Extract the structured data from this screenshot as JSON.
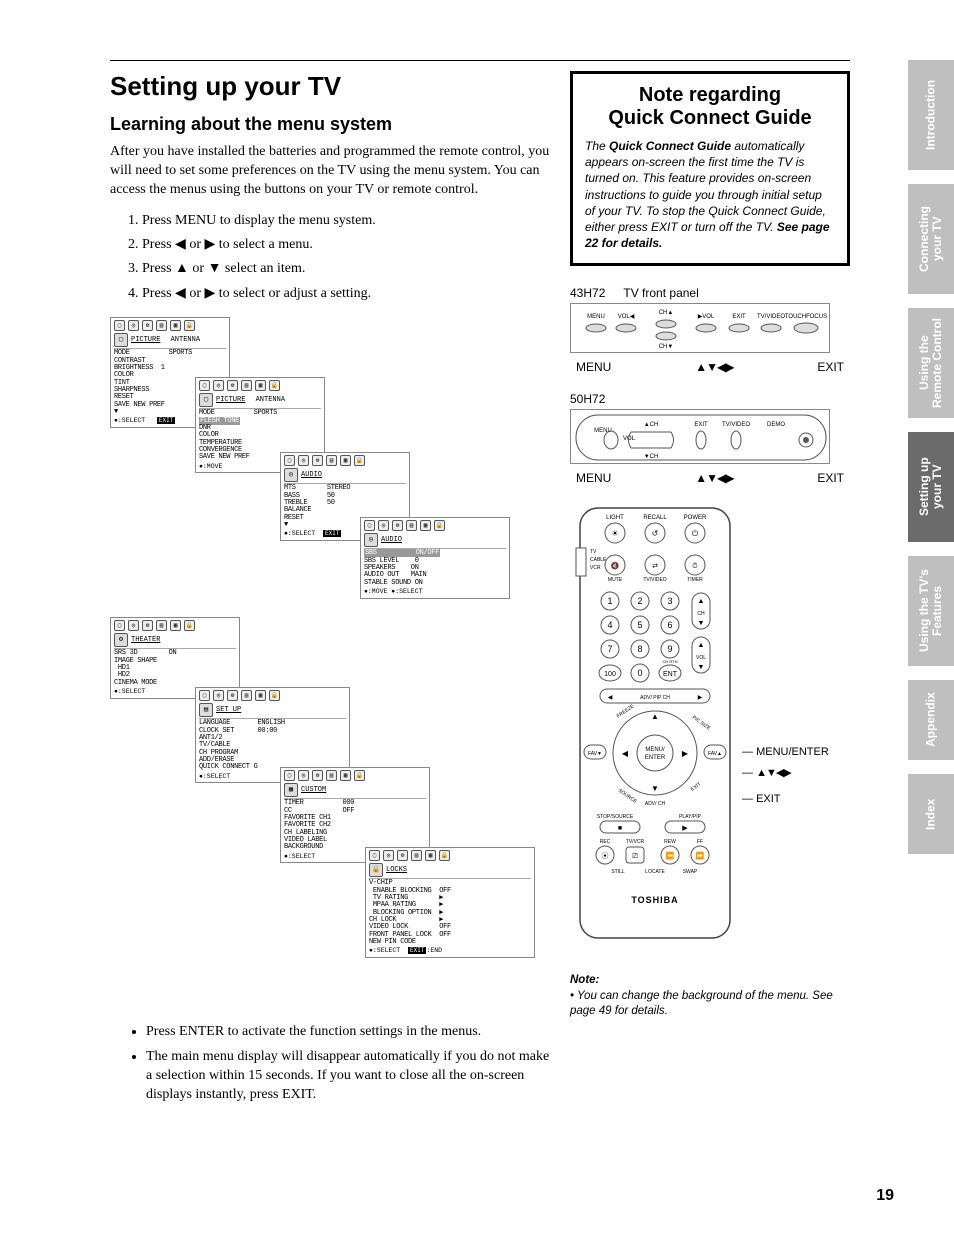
{
  "page_number": "19",
  "heading": "Setting up your TV",
  "subheading": "Learning about the menu system",
  "intro": "After you have installed the batteries and programmed the remote control, you will need to set some preferences on the TV using the menu system. You can access the menus using the buttons on your TV or remote control.",
  "steps": [
    "Press MENU to display the menu system.",
    "Press ◀ or ▶ to select a menu.",
    "Press ▲ or ▼ select an item.",
    "Press ◀ or ▶ to select or adjust a setting."
  ],
  "bullets": [
    "Press ENTER to activate the function settings in the menus.",
    "The main menu display will disappear automatically if you do not make a selection within 15 seconds. If you want to close all the on-screen displays instantly, press EXIT."
  ],
  "callout": {
    "title_line1": "Note regarding",
    "title_line2": "Quick Connect Guide",
    "body_lead": "The ",
    "body_bold1": "Quick Connect Guide",
    "body_mid": " automatically appears on-screen the first time the TV is turned on. This feature provides on-screen instructions to guide you through initial setup of your TV. To stop the Quick Connect Guide, either press EXIT or turn off the TV. ",
    "body_bold2": "See page 22 for details."
  },
  "panel1": {
    "model": "43H72",
    "label": "TV front panel",
    "buttons": [
      "MENU",
      "VOL◀",
      "CH▲",
      "▶VOL",
      "EXIT",
      "TV/VIDEO",
      "TOUCHFOCUS"
    ],
    "ch_down": "CH▼",
    "cap_left": "MENU",
    "cap_arrows": "▲▼◀▶",
    "cap_right": "EXIT"
  },
  "panel2": {
    "model": "50H72",
    "buttons_left": [
      "MENU",
      "VOL"
    ],
    "buttons_mid": [
      "CH",
      "CH"
    ],
    "buttons_right": [
      "EXIT",
      "TV/VIDEO",
      "DEMO"
    ],
    "cap_left": "MENU",
    "cap_arrows": "▲▼◀▶",
    "cap_right": "EXIT"
  },
  "remote": {
    "brand": "TOSHIBA",
    "top_row": [
      "LIGHT",
      "RECALL",
      "POWER"
    ],
    "side_switch": [
      "TV",
      "CABLE",
      "VCR"
    ],
    "row2": [
      "MUTE",
      "TV/VIDEO",
      "TIMER"
    ],
    "keypad": [
      [
        "1",
        "2",
        "3"
      ],
      [
        "4",
        "5",
        "6"
      ],
      [
        "7",
        "8",
        "9"
      ],
      [
        "100",
        "0",
        "ENT"
      ]
    ],
    "ch_label": "CH",
    "vol_label": "VOL",
    "chrtn": "CH RTN",
    "adv_pip": "ADV/\nPIP CH",
    "freeze": "FREEZE",
    "picsize": "PIC SIZE",
    "center": "MENU/\nENTER",
    "fav_l": "FAV▼",
    "fav_r": "FAV▲",
    "source": "SOURCE",
    "exit": "EXIT",
    "adv_ch": "ADV/\nCH",
    "stop_source": "STOP/SOURCE",
    "play_pip": "PLAY/PIP",
    "bottom_row": [
      "REC",
      "TV/VCR",
      "REW",
      "FF"
    ],
    "bottom_row2": [
      "STILL",
      "LOCATE",
      "SWAP"
    ],
    "annot_menu": "MENU/ENTER",
    "annot_arrows": "▲▼◀▶",
    "annot_exit": "EXIT"
  },
  "menus": {
    "picture": {
      "title": "PICTURE",
      "tab": "ANTENNA",
      "mode": "MODE          SPORTS",
      "items": "CONTRAST\nBRIGHTNESS  1\nCOLOR\nTINT\nSHARPNESS\nRESET\nSAVE NEW PREF\n▼",
      "foot": "●:SELECT",
      "exit": "EXIT"
    },
    "picture2": {
      "title": "PICTURE",
      "tab": "ANTENNA",
      "mode": "MODE          SPORTS",
      "hl": "FLESH TONE",
      "items": "DNR\nCOLOR\nTEMPERATURE\nCONVERGENCE\nSAVE NEW PREF",
      "foot": "●:MOVE"
    },
    "audio1": {
      "title": "AUDIO",
      "items": "MTS        STEREO\nBASS       50\nTREBLE     50\nBALANCE\nRESET\n▼",
      "foot": "●:SELECT",
      "exit": "EXIT"
    },
    "audio2": {
      "title": "AUDIO",
      "hl": "SBS          ON/OFF",
      "items": "SBS LEVEL    0\nSPEAKERS    ON\nAUDIO OUT   MAIN\nSTABLE SOUND ON",
      "foot": "●:MOVE    ●:SELECT"
    },
    "theater": {
      "title": "THEATER",
      "items": "SRS 3D        ON\nIMAGE SHAPE\n HD1\n HD2\nCINEMA MODE",
      "foot": "●:SELECT"
    },
    "setup": {
      "title": "SET UP",
      "items": "LANGUAGE       ENGLISH\nCLOCK SET      00:00\nANT1/2\nTV/CABLE\nCH PROGRAM\nADD/ERASE\nQUICK CONNECT G",
      "foot": "●:SELECT"
    },
    "custom": {
      "title": "CUSTOM",
      "items": "TIMER          000\nCC             OFF\nFAVORITE CH1\nFAVORITE CH2\nCH LABELING\nVIDEO LABEL\nBACKGROUND",
      "foot": "●:SELECT"
    },
    "locks": {
      "title": "LOCKS",
      "items": "V-CHIP\n ENABLE BLOCKING  OFF\n TV RATING        ▶\n MPAA RATING      ▶\n BLOCKING OPTION  ▶\nCH LOCK           ▶\nVIDEO LOCK        OFF\nFRONT PANEL LOCK  OFF\nNEW PIN CODE",
      "foot": "●:SELECT",
      "exit": "EXIT",
      "end": ":END"
    }
  },
  "bottom_note": {
    "heading": "Note:",
    "text": "You can change the background of the menu. See page 49 for details."
  },
  "side_tabs": [
    "Introduction",
    "Connecting\nyour TV",
    "Using the\nRemote Control",
    "Setting up\nyour TV",
    "Using the TV's\nFeatures",
    "Appendix",
    "Index"
  ]
}
